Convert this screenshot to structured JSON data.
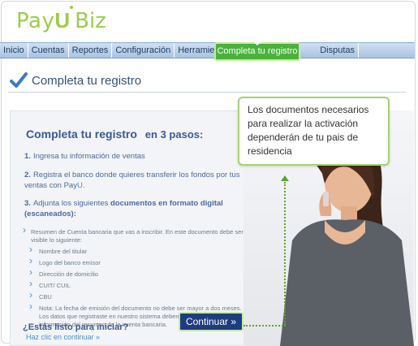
{
  "brand": {
    "pay": "Pay",
    "u": "U",
    "biz": "Biz"
  },
  "nav": {
    "items": [
      "Inicio",
      "Cuentas",
      "Reportes",
      "Configuración",
      "Herramientas"
    ],
    "active": "Completa tu registro",
    "after_active": "Disputas"
  },
  "page": {
    "title": "Completa tu registro"
  },
  "panel": {
    "heading": "Completa tu registro",
    "heading_sub": "en 3 pasos:",
    "steps": [
      {
        "num": "1.",
        "text": "Ingresa tu información de ventas"
      },
      {
        "num": "2.",
        "text": "Registra el banco donde quieres transferir los fondos por tus ventas con Pay",
        "link": "U."
      },
      {
        "num": "3.",
        "text": "Adjunta los siguientes",
        "bold": "documentos en formato digital (escaneados):"
      }
    ],
    "bullet_intro": "Resumen de Cuenta bancaria que vas a inscribir. En este documento debe ser visible lo siguiente:",
    "sub_bullets": [
      "Nombre del titular",
      "Logo del banco emisor",
      "Dirección de domicilio",
      "CUIT/ CUIL",
      "CBU",
      "Nota: La fecha de emisión del documento no debe ser mayor a dos meses. Los datos que registraste en nuestro sistema deben coincidir con la información del resumen de la cuenta bancaria."
    ],
    "ready_question": "¿Estás listo para iniciar?",
    "ready_link": "Haz clic en continuar »",
    "continue_label": "Continuar »"
  },
  "callout": {
    "text": "Los documentos necesarios para realizar la activación dependerán de tu pais de residencia"
  },
  "colors": {
    "brand_green": "#9ccc4c",
    "active_tab": "#47b33a",
    "button_navy": "#1d3d7e",
    "heading_blue": "#3c5a93"
  }
}
